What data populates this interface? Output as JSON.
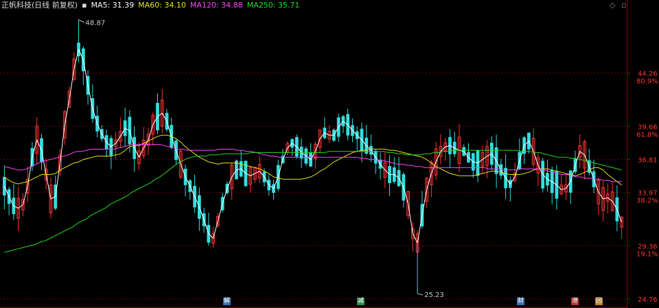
{
  "header": {
    "title": "正帆科技(日线 前复权)",
    "ma_items": [
      {
        "label": "MA5: 31.39",
        "color": "#ffffff"
      },
      {
        "label": "MA60: 34.10",
        "color": "#e5e51a"
      },
      {
        "label": "MA120: 34.88",
        "color": "#ff44ff"
      },
      {
        "label": "MA250: 35.71",
        "color": "#22dd22"
      }
    ],
    "right_icons": [
      {
        "icon": "diamond-icon",
        "glyph": "◇"
      },
      {
        "icon": "collapse-icon",
        "glyph": "▫"
      }
    ]
  },
  "events": [
    {
      "label": "解",
      "bg": "#3a6ea8"
    },
    {
      "label": "减",
      "bg": "#2c8a4a"
    },
    {
      "label": "财",
      "bg": "#3a6ea8"
    },
    {
      "label": "港",
      "bg": "#b03030"
    },
    {
      "label": "回",
      "bg": "#b08030"
    }
  ],
  "chart_data": {
    "type": "candlestick",
    "y_axis_prices": [
      "44.26",
      "39.66",
      "36.81",
      "33.97",
      "29.36",
      "24.76"
    ],
    "y_axis_percents": [
      "80.9%",
      "61.8%",
      "38.2%",
      "19.1%"
    ],
    "price_labels": [
      {
        "text": "48.87",
        "value": 48.87
      },
      {
        "text": "25.23",
        "value": 25.23
      }
    ],
    "ylim": [
      24.76,
      49.5
    ],
    "colors": {
      "up": "#ff3333",
      "down": "#33dddd",
      "grid": "#7a0000",
      "axis_text": "#ff3333",
      "axis_line": "#9a0000",
      "label_text": "#cccccc"
    },
    "series": [
      {
        "name": "MA5",
        "color": "#ffffff",
        "values": [
          34.5,
          33.6,
          32.8,
          32.6,
          32.9,
          34.5,
          37.0,
          38.5,
          37.6,
          35.5,
          33.4,
          33.6,
          36.5,
          39.8,
          42.0,
          44.6,
          46.3,
          45.4,
          43.2,
          41.2,
          39.9,
          39.0,
          38.3,
          37.9,
          38.2,
          38.8,
          39.5,
          39.3,
          37.8,
          37.0,
          37.8,
          38.5,
          39.8,
          40.5,
          40.8,
          40.1,
          38.8,
          37.6,
          36.4,
          35.3,
          34.5,
          33.6,
          32.7,
          31.6,
          30.4,
          30.0,
          31.5,
          33.0,
          34.3,
          35.3,
          35.9,
          36.0,
          35.6,
          35.4,
          35.6,
          35.8,
          35.3,
          34.6,
          34.3,
          35.3,
          36.8,
          37.8,
          38.2,
          37.9,
          37.4,
          37.1,
          36.8,
          37.5,
          38.6,
          39.1,
          38.9,
          38.9,
          39.6,
          40.1,
          39.8,
          39.3,
          38.9,
          38.5,
          38.0,
          37.6,
          37.0,
          36.4,
          35.9,
          35.5,
          35.5,
          35.2,
          34.4,
          33.0,
          30.4,
          29.6,
          32.0,
          34.2,
          35.6,
          36.6,
          37.5,
          37.9,
          38.0,
          37.8,
          37.6,
          37.5,
          37.0,
          36.6,
          36.5,
          36.8,
          37.1,
          37.3,
          36.7,
          35.9,
          35.2,
          34.7,
          35.3,
          36.7,
          38.0,
          38.4,
          37.5,
          36.3,
          35.5,
          35.1,
          34.9,
          34.6,
          34.2,
          34.3,
          34.9,
          36.3,
          37.5,
          37.2,
          36.2,
          35.1,
          34.0,
          33.4,
          33.5,
          33.2,
          32.5,
          31.4
        ]
      },
      {
        "name": "MA60",
        "color": "#e5e51a",
        "values": [
          35.3,
          35.0,
          34.8,
          34.7,
          34.8,
          34.9,
          35.1,
          35.3,
          35.5,
          35.5,
          35.5,
          35.6,
          35.9,
          36.1,
          36.3,
          36.5,
          36.6,
          36.8,
          36.9,
          37.0,
          37.1,
          37.1,
          37.1,
          37.1,
          37.2,
          37.3,
          37.6,
          37.9,
          38.0,
          38.0,
          38.2,
          38.4,
          38.6,
          38.8,
          38.9,
          38.9,
          38.8,
          38.6,
          38.3,
          37.9,
          37.6,
          37.3,
          37.0,
          36.8,
          36.6,
          36.5,
          36.4,
          36.5,
          36.5,
          36.5,
          36.5,
          36.4,
          36.3,
          36.2,
          36.1,
          36.0,
          35.8,
          35.6,
          35.3,
          35.2,
          35.1,
          35.1,
          35.1,
          35.1,
          35.1,
          35.2,
          35.3,
          35.5,
          35.8,
          36.0,
          36.3,
          36.6,
          36.8,
          37.0,
          37.2,
          37.4,
          37.5,
          37.6,
          37.6,
          37.7,
          37.7,
          37.7,
          37.7,
          37.6,
          37.6,
          37.5,
          37.4,
          37.3,
          37.2,
          37.1,
          37.0,
          36.8,
          36.5,
          36.2,
          36.0,
          35.8,
          35.6,
          35.5,
          35.4,
          35.4,
          35.4,
          35.4,
          35.5,
          35.6,
          35.7,
          35.8,
          35.8,
          35.7,
          35.6,
          35.5,
          35.5,
          35.5,
          35.6,
          35.7,
          35.9,
          36.0,
          36.0,
          36.0,
          35.9,
          35.8,
          35.7,
          35.6,
          35.5,
          35.4,
          35.5,
          35.7,
          35.9,
          36.1,
          36.1,
          35.9,
          35.5,
          35.2,
          34.9,
          34.6
        ]
      },
      {
        "name": "MA120",
        "color": "#ff44ff",
        "values": [
          36.2,
          36.1,
          36.0,
          35.9,
          35.9,
          36.0,
          36.2,
          36.4,
          36.6,
          36.7,
          36.8,
          36.9,
          37.0,
          37.1,
          37.2,
          37.4,
          37.5,
          37.5,
          37.6,
          37.7,
          37.7,
          37.7,
          37.7,
          37.7,
          37.7,
          37.8,
          37.9,
          38.0,
          38.1,
          38.1,
          38.1,
          38.1,
          38.1,
          38.1,
          38.1,
          38.0,
          37.9,
          37.8,
          37.7,
          37.7,
          37.6,
          37.6,
          37.6,
          37.6,
          37.6,
          37.6,
          37.6,
          37.7,
          37.7,
          37.7,
          37.7,
          37.6,
          37.6,
          37.5,
          37.5,
          37.4,
          37.3,
          37.2,
          37.1,
          37.1,
          37.0,
          37.0,
          37.0,
          37.0,
          37.0,
          37.0,
          37.0,
          37.0,
          37.0,
          37.0,
          37.0,
          37.0,
          37.0,
          37.0,
          37.0,
          37.0,
          37.0,
          37.0,
          36.9,
          36.9,
          36.8,
          36.8,
          36.7,
          36.7,
          36.6,
          36.5,
          36.4,
          36.4,
          36.3,
          36.3,
          36.2,
          36.2,
          36.1,
          36.1,
          36.1,
          36.1,
          36.1,
          36.1,
          36.1,
          36.1,
          36.1,
          36.1,
          36.1,
          36.1,
          36.1,
          36.1,
          36.0,
          36.0,
          36.0,
          35.9,
          35.9,
          35.9,
          35.9,
          36.0,
          36.0,
          36.0,
          36.0,
          36.0,
          35.9,
          35.8,
          35.7,
          35.6,
          35.5,
          35.5,
          35.4,
          35.3,
          35.3,
          35.2,
          35.2,
          35.1,
          35.1,
          35.0,
          35.0,
          34.9,
          34.9,
          34.9
        ]
      },
      {
        "name": "MA250",
        "color": "#22dd22",
        "values": [
          28.8,
          28.9,
          29.0,
          29.1,
          29.2,
          29.3,
          29.4,
          29.5,
          29.7,
          29.8,
          30.0,
          30.2,
          30.4,
          30.6,
          30.8,
          31.0,
          31.3,
          31.5,
          31.7,
          32.0,
          32.2,
          32.4,
          32.6,
          32.9,
          33.1,
          33.3,
          33.5,
          33.7,
          34.0,
          34.2,
          34.4,
          34.6,
          34.8,
          35.1,
          35.3,
          35.6,
          35.9,
          36.2,
          36.5,
          36.7,
          36.9,
          37.0,
          37.1,
          37.1,
          37.1,
          37.2,
          37.2,
          37.2,
          37.3,
          37.3,
          37.3,
          37.3,
          37.3,
          37.3,
          37.4,
          37.4,
          37.4,
          37.4,
          37.4,
          37.4,
          37.4,
          37.4,
          37.4,
          37.4,
          37.4,
          37.4,
          37.4,
          37.4,
          37.4,
          37.4,
          37.4,
          37.5,
          37.5,
          37.5,
          37.5,
          37.5,
          37.5,
          37.5,
          37.5,
          37.5,
          37.5,
          37.5,
          37.5,
          37.5,
          37.4,
          37.4,
          37.3,
          37.3,
          37.2,
          37.2,
          37.2,
          37.2,
          37.3,
          37.3,
          37.4,
          37.4,
          37.5,
          37.5,
          37.6,
          37.6,
          37.6,
          37.6,
          37.6,
          37.6,
          37.6,
          37.6,
          37.6,
          37.6,
          37.6,
          37.6,
          37.6,
          37.6,
          37.6,
          37.5,
          37.5,
          37.5,
          37.4,
          37.4,
          37.3,
          37.2,
          37.1,
          37.0,
          37.0,
          37.0,
          36.9,
          36.9,
          36.8,
          36.7,
          36.6,
          36.5,
          36.4,
          36.3,
          36.2,
          36.1,
          36.0,
          35.9
        ]
      }
    ]
  }
}
